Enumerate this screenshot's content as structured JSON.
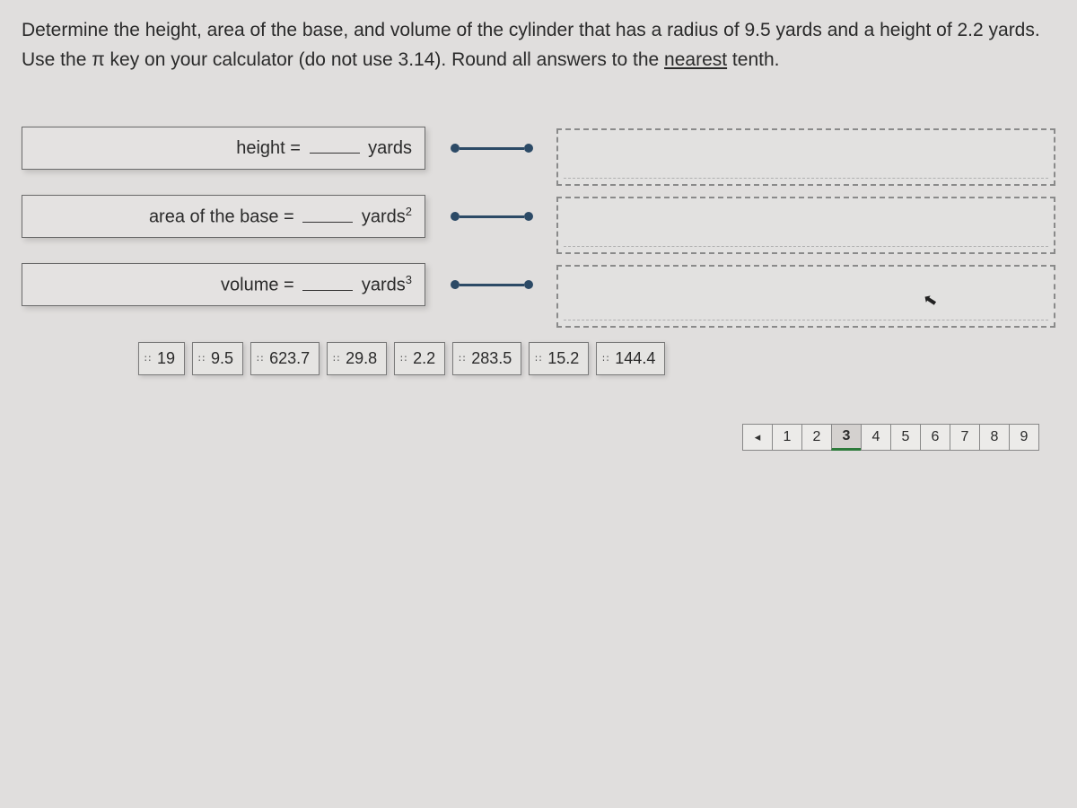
{
  "question": {
    "full_text": "Determine the height, area of the base, and volume of the cylinder that has a radius of 9.5 yards and a height of 2.2 yards. Use the π key on your calculator (do not use 3.14). Round all answers to the nearest tenth.",
    "underline_word": "nearest"
  },
  "answers": [
    {
      "label_pre": "height =",
      "label_post": "yards",
      "sup": ""
    },
    {
      "label_pre": "area of the base =",
      "label_post": "yards",
      "sup": "2"
    },
    {
      "label_pre": "volume =",
      "label_post": "yards",
      "sup": "3"
    }
  ],
  "tokens": [
    "19",
    "9.5",
    "623.7",
    "29.8",
    "2.2",
    "283.5",
    "15.2",
    "144.4"
  ],
  "pager": {
    "prev_glyph": "◂",
    "pages": [
      "1",
      "2",
      "3",
      "4",
      "5",
      "6",
      "7",
      "8",
      "9"
    ],
    "active_index": 2
  },
  "cursor_glyph": "↖"
}
